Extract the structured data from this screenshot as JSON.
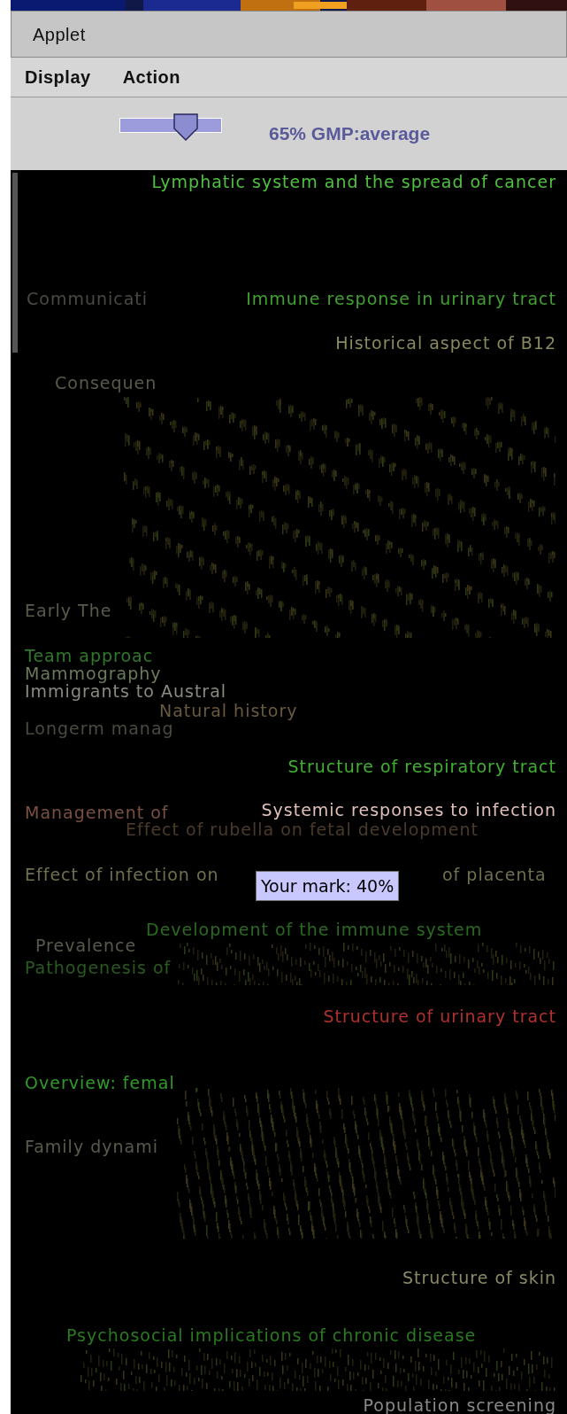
{
  "window": {
    "title": "Applet"
  },
  "menu": [
    {
      "label": "Display"
    },
    {
      "label": "Action"
    }
  ],
  "slider": {
    "level": 0.65,
    "reading": "65% GMP:average"
  },
  "topics": [
    {
      "text": "Lymphatic system and the spread of cancer",
      "color": "#50c040"
    },
    {
      "text": "Communicati",
      "color": "#4a4a44"
    },
    {
      "text": "Immune response in urinary tract",
      "color": "#40a030"
    },
    {
      "text": "Historical aspect of B12",
      "color": "#8a8a60"
    },
    {
      "text": "Consequen",
      "color": "#5a5a48"
    },
    {
      "text": "Early The",
      "color": "#5a5a4c"
    },
    {
      "text": "Team approac",
      "color": "#2f7a2a"
    },
    {
      "text": "Mammography",
      "color": "#6a7a5a"
    },
    {
      "text": "Immigrants to Austral",
      "color": "#8a8a80"
    },
    {
      "text": "Natural history",
      "color": "#6a5a40"
    },
    {
      "text": "Longerm manag",
      "color": "#4a4a40"
    },
    {
      "text": "Structure of respiratory tract",
      "color": "#40b030"
    },
    {
      "text": "Management of",
      "color": "#7a5040"
    },
    {
      "text": "Systemic responses to infection",
      "color": "#e0c0b8"
    },
    {
      "text": "Effect of rubella on fetal development",
      "color": "#4a3a2a"
    },
    {
      "text": "Effect of infection on",
      "color": "#707050"
    },
    {
      "text": "of placenta",
      "color": "#707050"
    },
    {
      "text": "Development of the immune system",
      "color": "#2a6a20"
    },
    {
      "text": "Prevalence",
      "color": "#5a5a4c"
    },
    {
      "text": "Pathogenesis of",
      "color": "#2a5a20"
    },
    {
      "text": "Structure of urinary tract",
      "color": "#b03030"
    },
    {
      "text": "Overview: femal",
      "color": "#309a2a"
    },
    {
      "text": "Family dynami",
      "color": "#5a5a4c"
    },
    {
      "text": "Structure of skin",
      "color": "#8a8a68"
    },
    {
      "text": "Psychosocial implications of chronic disease",
      "color": "#2a7a20"
    },
    {
      "text": "Population screening",
      "color": "#8a8a88"
    }
  ],
  "tooltip": {
    "text": "Your mark: 40%"
  }
}
